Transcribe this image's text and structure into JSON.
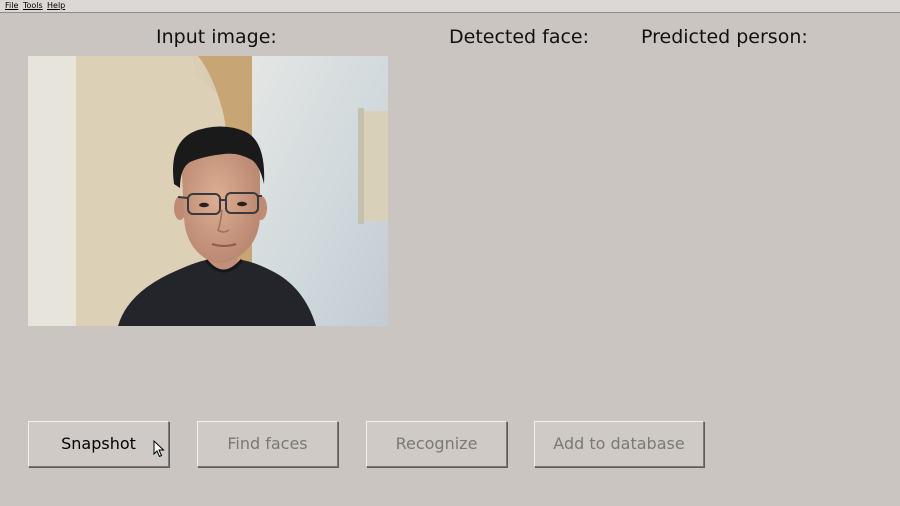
{
  "menubar": {
    "items": [
      {
        "label": "File"
      },
      {
        "label": "Tools"
      },
      {
        "label": "Help"
      }
    ]
  },
  "headings": {
    "input_image": "Input image:",
    "detected_face": "Detected face:",
    "predicted_person": "Predicted person:"
  },
  "buttons": {
    "snapshot": {
      "label": "Snapshot",
      "enabled": true
    },
    "find_faces": {
      "label": "Find faces",
      "enabled": false
    },
    "recognize": {
      "label": "Recognize",
      "enabled": false
    },
    "add_to_database": {
      "label": "Add to database",
      "enabled": false
    }
  },
  "colors": {
    "window_background": "#cac5c1",
    "disabled_text": "#7b7875",
    "enabled_text": "#000000"
  },
  "icons": {
    "cursor": "mouse-pointer-icon"
  }
}
